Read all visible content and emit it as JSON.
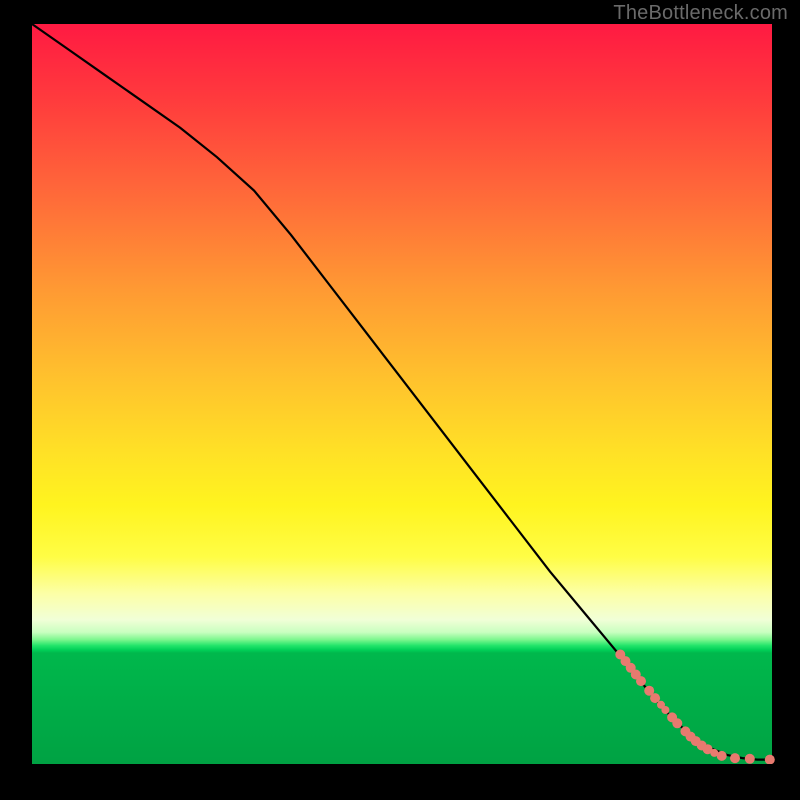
{
  "watermark": "TheBottleneck.com",
  "colors": {
    "curve": "#000000",
    "dots": "#e77a6f"
  },
  "chart_data": {
    "type": "line",
    "title": "",
    "xlabel": "",
    "ylabel": "",
    "xlim": [
      0,
      100
    ],
    "ylim": [
      0,
      100
    ],
    "grid": false,
    "series": [
      {
        "name": "curve",
        "style": "line",
        "color": "#000000",
        "x": [
          0,
          5,
          10,
          15,
          20,
          25,
          30,
          35,
          40,
          45,
          50,
          55,
          60,
          65,
          70,
          75,
          80,
          82,
          84,
          86,
          88,
          90,
          92,
          94,
          96,
          98,
          100
        ],
        "y": [
          100,
          96.5,
          93,
          89.5,
          86,
          82,
          77.5,
          71.5,
          65,
          58.5,
          52,
          45.5,
          39,
          32.5,
          26,
          20,
          14,
          11.5,
          9,
          6.8,
          4.8,
          3.2,
          2,
          1.2,
          0.8,
          0.6,
          0.6
        ]
      },
      {
        "name": "cluster",
        "style": "scatter",
        "color": "#e77a6f",
        "points": [
          {
            "x": 79.5,
            "y": 14.8,
            "r": 5
          },
          {
            "x": 80.2,
            "y": 13.9,
            "r": 5
          },
          {
            "x": 80.9,
            "y": 13.0,
            "r": 5
          },
          {
            "x": 81.6,
            "y": 12.1,
            "r": 5
          },
          {
            "x": 82.3,
            "y": 11.2,
            "r": 5
          },
          {
            "x": 83.4,
            "y": 9.9,
            "r": 5
          },
          {
            "x": 84.2,
            "y": 8.9,
            "r": 5
          },
          {
            "x": 85.0,
            "y": 8.0,
            "r": 4
          },
          {
            "x": 85.6,
            "y": 7.3,
            "r": 4
          },
          {
            "x": 86.5,
            "y": 6.3,
            "r": 5
          },
          {
            "x": 87.2,
            "y": 5.5,
            "r": 5
          },
          {
            "x": 88.3,
            "y": 4.4,
            "r": 5
          },
          {
            "x": 89.0,
            "y": 3.7,
            "r": 5
          },
          {
            "x": 89.7,
            "y": 3.1,
            "r": 5
          },
          {
            "x": 90.5,
            "y": 2.5,
            "r": 5
          },
          {
            "x": 91.3,
            "y": 2.0,
            "r": 5
          },
          {
            "x": 92.2,
            "y": 1.5,
            "r": 4
          },
          {
            "x": 93.2,
            "y": 1.1,
            "r": 5
          },
          {
            "x": 95.0,
            "y": 0.8,
            "r": 5
          },
          {
            "x": 97.0,
            "y": 0.7,
            "r": 5
          },
          {
            "x": 99.7,
            "y": 0.6,
            "r": 5
          }
        ]
      }
    ]
  }
}
